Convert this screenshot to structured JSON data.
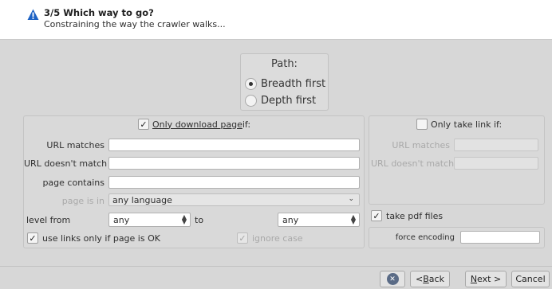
{
  "header": {
    "title": "3/5 Which way to go?",
    "subtitle": "Constraining the way the crawler walks...",
    "icon": "warning-icon"
  },
  "path": {
    "title": "Path:",
    "options": [
      {
        "label": "Breadth first",
        "selected": true
      },
      {
        "label": "Depth first",
        "selected": false
      }
    ]
  },
  "download": {
    "checkbox_label_prefix": "Only download page",
    "checkbox_label_suffix": " if:",
    "checked": true,
    "url_matches_label": "URL matches",
    "url_matches_value": "",
    "url_not_match_label": "URL doesn't match",
    "url_not_match_value": "",
    "page_contains_label": "page contains",
    "page_contains_value": "",
    "page_is_in_label": "page is in",
    "page_is_in_value": "any language",
    "level_from_label": "level from",
    "level_from_value": "any",
    "level_to_label": "to",
    "level_to_value": "any",
    "links_only_ok_label": "use links only if page is OK",
    "links_only_ok_checked": true,
    "ignore_case_label": "ignore case",
    "ignore_case_checked": true
  },
  "link": {
    "checkbox_label": "Only take link if:",
    "checked": false,
    "url_matches_label": "URL matches",
    "url_not_match_label": "URL doesn't match",
    "take_pdf_label": "take pdf files",
    "take_pdf_checked": true,
    "force_encoding_label": "force encoding",
    "force_encoding_value": ""
  },
  "footer": {
    "back_prefix": "< ",
    "back_underline": "B",
    "back_rest": "ack",
    "next_underline": "N",
    "next_rest": "ext >",
    "cancel_label": "Cancel",
    "help_icon": "help-icon"
  },
  "colors": {
    "window_bg": "#d7d7d7",
    "header_bg": "#ffffff",
    "warning_icon": "#1d62c4"
  }
}
